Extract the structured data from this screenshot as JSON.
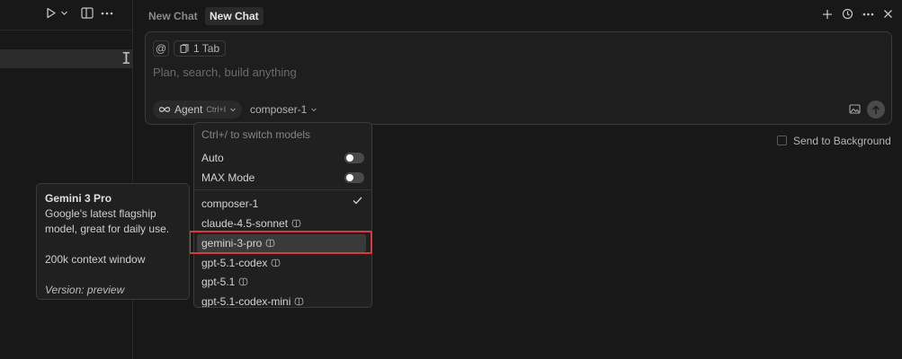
{
  "tabs": [
    {
      "label": "New Chat",
      "active": false
    },
    {
      "label": "New Chat",
      "active": true
    }
  ],
  "composer": {
    "at_label": "@",
    "tab_chip": "1 Tab",
    "placeholder": "Plan, search, build anything",
    "agent_label": "Agent",
    "agent_shortcut": "Ctrl+I",
    "model_label": "composer-1"
  },
  "send_to_background": "Send to Background",
  "dropdown": {
    "hint": "Ctrl+/ to switch models",
    "auto_label": "Auto",
    "auto_enabled": false,
    "max_label": "MAX Mode",
    "max_enabled": false,
    "models": [
      {
        "name": "composer-1",
        "checked": true,
        "brain": false
      },
      {
        "name": "claude-4.5-sonnet",
        "brain": true
      },
      {
        "name": "gemini-3-pro",
        "brain": true,
        "hovered": true
      },
      {
        "name": "gpt-5.1-codex",
        "brain": true
      },
      {
        "name": "gpt-5.1",
        "brain": true
      },
      {
        "name": "gpt-5.1-codex-mini",
        "brain": true
      }
    ]
  },
  "tooltip": {
    "title": "Gemini 3 Pro",
    "description": "Google's latest flagship model, great for daily use.",
    "context": "200k context window",
    "version": "Version: preview"
  },
  "colors": {
    "background": "#181818",
    "highlight": "#d93a3f"
  },
  "icons": {
    "run": "play-icon",
    "layout": "split-layout-icon",
    "more": "more-icon",
    "new_chat": "plus-icon",
    "history": "history-icon",
    "close": "close-icon",
    "brain": "brain-icon",
    "image": "image-icon",
    "send": "arrow-up-icon",
    "infinity": "infinity-icon",
    "check": "check-icon"
  }
}
